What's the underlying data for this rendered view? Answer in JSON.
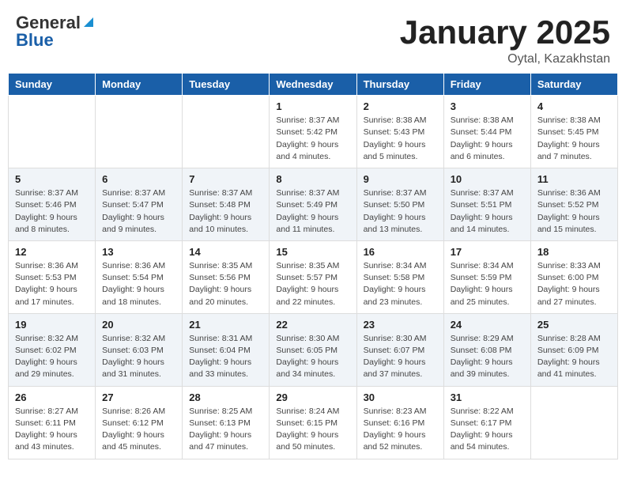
{
  "header": {
    "logo_general": "General",
    "logo_blue": "Blue",
    "title": "January 2025",
    "subtitle": "Oytal, Kazakhstan"
  },
  "weekdays": [
    "Sunday",
    "Monday",
    "Tuesday",
    "Wednesday",
    "Thursday",
    "Friday",
    "Saturday"
  ],
  "weeks": [
    [
      {
        "day": "",
        "info": ""
      },
      {
        "day": "",
        "info": ""
      },
      {
        "day": "",
        "info": ""
      },
      {
        "day": "1",
        "info": "Sunrise: 8:37 AM\nSunset: 5:42 PM\nDaylight: 9 hours\nand 4 minutes."
      },
      {
        "day": "2",
        "info": "Sunrise: 8:38 AM\nSunset: 5:43 PM\nDaylight: 9 hours\nand 5 minutes."
      },
      {
        "day": "3",
        "info": "Sunrise: 8:38 AM\nSunset: 5:44 PM\nDaylight: 9 hours\nand 6 minutes."
      },
      {
        "day": "4",
        "info": "Sunrise: 8:38 AM\nSunset: 5:45 PM\nDaylight: 9 hours\nand 7 minutes."
      }
    ],
    [
      {
        "day": "5",
        "info": "Sunrise: 8:37 AM\nSunset: 5:46 PM\nDaylight: 9 hours\nand 8 minutes."
      },
      {
        "day": "6",
        "info": "Sunrise: 8:37 AM\nSunset: 5:47 PM\nDaylight: 9 hours\nand 9 minutes."
      },
      {
        "day": "7",
        "info": "Sunrise: 8:37 AM\nSunset: 5:48 PM\nDaylight: 9 hours\nand 10 minutes."
      },
      {
        "day": "8",
        "info": "Sunrise: 8:37 AM\nSunset: 5:49 PM\nDaylight: 9 hours\nand 11 minutes."
      },
      {
        "day": "9",
        "info": "Sunrise: 8:37 AM\nSunset: 5:50 PM\nDaylight: 9 hours\nand 13 minutes."
      },
      {
        "day": "10",
        "info": "Sunrise: 8:37 AM\nSunset: 5:51 PM\nDaylight: 9 hours\nand 14 minutes."
      },
      {
        "day": "11",
        "info": "Sunrise: 8:36 AM\nSunset: 5:52 PM\nDaylight: 9 hours\nand 15 minutes."
      }
    ],
    [
      {
        "day": "12",
        "info": "Sunrise: 8:36 AM\nSunset: 5:53 PM\nDaylight: 9 hours\nand 17 minutes."
      },
      {
        "day": "13",
        "info": "Sunrise: 8:36 AM\nSunset: 5:54 PM\nDaylight: 9 hours\nand 18 minutes."
      },
      {
        "day": "14",
        "info": "Sunrise: 8:35 AM\nSunset: 5:56 PM\nDaylight: 9 hours\nand 20 minutes."
      },
      {
        "day": "15",
        "info": "Sunrise: 8:35 AM\nSunset: 5:57 PM\nDaylight: 9 hours\nand 22 minutes."
      },
      {
        "day": "16",
        "info": "Sunrise: 8:34 AM\nSunset: 5:58 PM\nDaylight: 9 hours\nand 23 minutes."
      },
      {
        "day": "17",
        "info": "Sunrise: 8:34 AM\nSunset: 5:59 PM\nDaylight: 9 hours\nand 25 minutes."
      },
      {
        "day": "18",
        "info": "Sunrise: 8:33 AM\nSunset: 6:00 PM\nDaylight: 9 hours\nand 27 minutes."
      }
    ],
    [
      {
        "day": "19",
        "info": "Sunrise: 8:32 AM\nSunset: 6:02 PM\nDaylight: 9 hours\nand 29 minutes."
      },
      {
        "day": "20",
        "info": "Sunrise: 8:32 AM\nSunset: 6:03 PM\nDaylight: 9 hours\nand 31 minutes."
      },
      {
        "day": "21",
        "info": "Sunrise: 8:31 AM\nSunset: 6:04 PM\nDaylight: 9 hours\nand 33 minutes."
      },
      {
        "day": "22",
        "info": "Sunrise: 8:30 AM\nSunset: 6:05 PM\nDaylight: 9 hours\nand 34 minutes."
      },
      {
        "day": "23",
        "info": "Sunrise: 8:30 AM\nSunset: 6:07 PM\nDaylight: 9 hours\nand 37 minutes."
      },
      {
        "day": "24",
        "info": "Sunrise: 8:29 AM\nSunset: 6:08 PM\nDaylight: 9 hours\nand 39 minutes."
      },
      {
        "day": "25",
        "info": "Sunrise: 8:28 AM\nSunset: 6:09 PM\nDaylight: 9 hours\nand 41 minutes."
      }
    ],
    [
      {
        "day": "26",
        "info": "Sunrise: 8:27 AM\nSunset: 6:11 PM\nDaylight: 9 hours\nand 43 minutes."
      },
      {
        "day": "27",
        "info": "Sunrise: 8:26 AM\nSunset: 6:12 PM\nDaylight: 9 hours\nand 45 minutes."
      },
      {
        "day": "28",
        "info": "Sunrise: 8:25 AM\nSunset: 6:13 PM\nDaylight: 9 hours\nand 47 minutes."
      },
      {
        "day": "29",
        "info": "Sunrise: 8:24 AM\nSunset: 6:15 PM\nDaylight: 9 hours\nand 50 minutes."
      },
      {
        "day": "30",
        "info": "Sunrise: 8:23 AM\nSunset: 6:16 PM\nDaylight: 9 hours\nand 52 minutes."
      },
      {
        "day": "31",
        "info": "Sunrise: 8:22 AM\nSunset: 6:17 PM\nDaylight: 9 hours\nand 54 minutes."
      },
      {
        "day": "",
        "info": ""
      }
    ]
  ]
}
